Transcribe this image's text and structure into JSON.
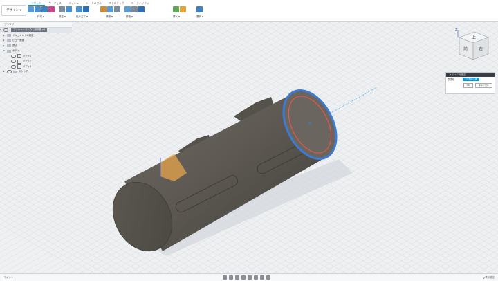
{
  "toolbar": {
    "design_label": "デザイン ▾",
    "tabs": [
      "ソリッド",
      "サーフェス",
      "メッシュ",
      "シートメタル",
      "プラスチック",
      "ユーティリティ"
    ],
    "groups": [
      "作成 ▾",
      "修正 ▾",
      "組み立て ▾",
      "構築 ▾",
      "検査 ▾",
      "挿入 ▾",
      "選択 ▾"
    ]
  },
  "browser": {
    "title": "ブラウザ",
    "items": [
      {
        "label": "ブッシャーラックと試作品 v4"
      },
      {
        "label": "ドキュメントの設定"
      },
      {
        "label": "ビュー画像"
      },
      {
        "label": "原点"
      },
      {
        "label": "ボディ"
      },
      {
        "label": "ボディ1"
      },
      {
        "label": "ボディ2"
      },
      {
        "label": "ボディ3"
      },
      {
        "label": "スケッチ"
      }
    ]
  },
  "viewcube": {
    "top": "上",
    "front": "前",
    "right": "右",
    "axis_z": "Z"
  },
  "dialog": {
    "title": "▸ シーンの設定",
    "row_label": "環境光",
    "button": "▾ 片側の平面",
    "ok": "OK",
    "cancel": "キャンセル"
  },
  "bottom": {
    "left": "コメント",
    "right": "◢ 表示設定"
  },
  "colors": {
    "accent": "#0696d7",
    "model": "#5e5a53",
    "selection": "#3d7bd6",
    "sketch": "#e0584a"
  }
}
